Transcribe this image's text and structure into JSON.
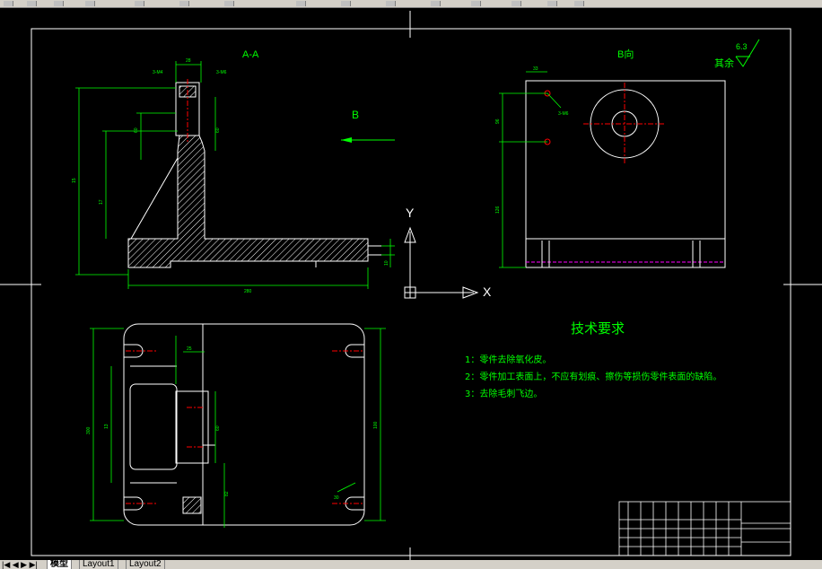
{
  "drawing": {
    "section_title": "A-A",
    "b_label": "B",
    "b_view_title": "B向",
    "surface_finish": {
      "label": "其余",
      "value": "6.3"
    },
    "ucs": {
      "x_label": "X",
      "y_label": "Y"
    },
    "tech_requirements": {
      "title": "技术要求",
      "items": [
        "1：零件去除氧化皮。",
        "2：零件加工表面上，不应有划痕、擦伤等损伤零件表面的缺陷。",
        "3：去除毛刺飞边。"
      ]
    },
    "dimensions": {
      "section": [
        "28",
        "3-M4",
        "3-M6",
        "52",
        "60",
        "60",
        "10",
        "15",
        "98",
        "300",
        "138",
        "280",
        "17",
        "10"
      ],
      "b_view": [
        "33",
        "3-M6",
        "96",
        "126"
      ],
      "plan": [
        "52",
        "8",
        "13",
        "300",
        "25",
        "52",
        "25",
        "60",
        "100",
        "82",
        "17",
        "30",
        "25"
      ]
    }
  },
  "colors": {
    "background": "#000000",
    "outline": "#ffffff",
    "dimension": "#00ff00",
    "centerline": "#ff0000",
    "hidden": "#ff00ff",
    "text": "#00ff00"
  },
  "layout_tabs": {
    "nav": "|◀ ◀ ▶ ▶|",
    "model": "模型",
    "layout1": "Layout1",
    "layout2": "Layout2"
  }
}
